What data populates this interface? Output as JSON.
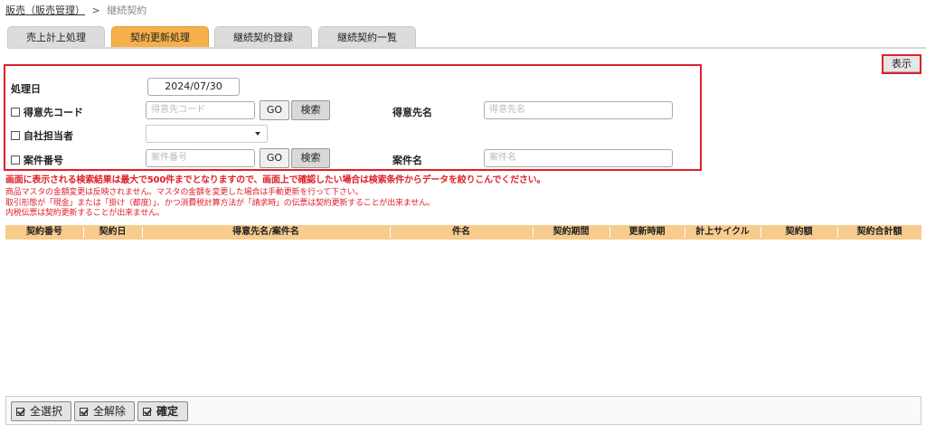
{
  "breadcrumb": {
    "parent": "販売（販売管理）",
    "separator": ">",
    "current": "継続契約"
  },
  "tabs": [
    "売上計上処理",
    "契約更新処理",
    "継続契約登録",
    "継続契約一覧"
  ],
  "active_tab": "契約更新処理",
  "display_button": "表示",
  "search": {
    "processing_date_label": "処理日",
    "processing_date_value": "2024/07/30",
    "customer_code_label": "得意先コード",
    "customer_code_placeholder": "得意先コード",
    "go_label": "GO",
    "search_label": "検索",
    "customer_name_label": "得意先名",
    "customer_name_placeholder": "得意先名",
    "staff_label": "自社担当者",
    "project_no_label": "案件番号",
    "project_no_placeholder": "案件番号",
    "project_name_label": "案件名",
    "project_name_placeholder": "案件名"
  },
  "warning": "画面に表示される検索結果は最大で500件までとなりますので、画面上で確認したい場合は検索条件からデータを絞りこんでください。",
  "notes": [
    "商品マスタの金額変更は反映されません。マスタの金額を変更した場合は手動更新を行って下さい。",
    "取引形態が「現金」または「掛け（都度）」、かつ消費税計算方法が「請求時」の伝票は契約更新することが出来ません。",
    "内税伝票は契約更新することが出来ません。"
  ],
  "table": {
    "columns": [
      "契約番号",
      "契約日",
      "得意先名/案件名",
      "件名",
      "契約期間",
      "更新時期",
      "計上サイクル",
      "契約額",
      "契約合計額"
    ]
  },
  "footer": {
    "select_all": "全選択",
    "deselect_all": "全解除",
    "confirm": "確定"
  },
  "colors": {
    "accent_tab": "#f6b04a",
    "table_header": "#f8cc8c",
    "warning_red": "#e0202a"
  }
}
